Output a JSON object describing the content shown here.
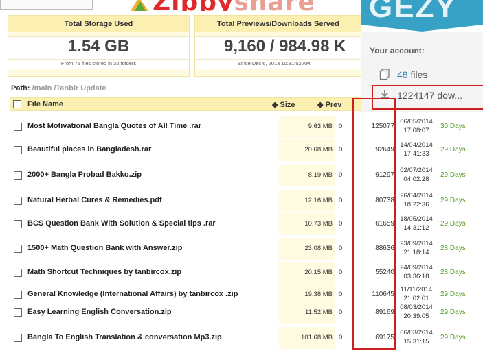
{
  "header": {
    "logo": {
      "part1": "Zippy",
      "part2": "share"
    },
    "badge_text": "GEZY"
  },
  "storage": {
    "title": "Total Storage Used",
    "value": "1.54 GB",
    "subtitle": "From  75 files stored in 32 folders"
  },
  "previews": {
    "title": "Total Previews/Downloads Served",
    "value": "9,160 / 984.98 K",
    "subtitle": "Since Dec 6, 2013 10:31:52 AM"
  },
  "account": {
    "title": "Your account:",
    "files": {
      "count": "48",
      "label": "files",
      "icon": "files-icon"
    },
    "downloads": {
      "text": "1224147 dow...",
      "icon": "download-icon"
    }
  },
  "path": {
    "label": "Path:",
    "value": "/main /Tanbir Update"
  },
  "table": {
    "headers": {
      "name": "File Name",
      "size": "Size",
      "prev": "Prev"
    },
    "rows": [
      {
        "name": "Most Motivational Bangla Quotes of All Time .rar",
        "size": "9.63 MB",
        "prev": "0",
        "downloads": "125077",
        "date": "06/05/2014",
        "time": "17:08:07",
        "days": "30 Days"
      },
      {
        "name": "Beautiful places in Bangladesh.rar",
        "size": "20.68 MB",
        "prev": "0",
        "downloads": "92649",
        "date": "14/04/2014",
        "time": "17:41:33",
        "days": "29 Days"
      },
      {
        "name": "2000+ Bangla Probad Bakko.zip",
        "size": "8.19 MB",
        "prev": "0",
        "downloads": "91297",
        "date": "02/07/2014",
        "time": "04:02:28",
        "days": "29 Days"
      },
      {
        "name": "Natural Herbal Cures & Remedies.pdf",
        "size": "12.16 MB",
        "prev": "0",
        "downloads": "80738",
        "date": "26/04/2014",
        "time": "18:22:36",
        "days": "29 Days"
      },
      {
        "name": "BCS Question Bank With Solution & Special tips .rar",
        "size": "10.73 MB",
        "prev": "0",
        "downloads": "61659",
        "date": "18/05/2014",
        "time": "14:31:12",
        "days": "29 Days"
      },
      {
        "name": "1500+ Math Question Bank with Answer.zip",
        "size": "23.08 MB",
        "prev": "0",
        "downloads": "88636",
        "date": "23/09/2014",
        "time": "21:18:14",
        "days": "28 Days"
      },
      {
        "name": "Math Shortcut Techniques by tanbircox.zip",
        "size": "20.15 MB",
        "prev": "0",
        "downloads": "55240",
        "date": "24/09/2014",
        "time": "03:36:18",
        "days": "28 Days"
      },
      {
        "name": "General Knowledge (International Affairs) by tanbircox .zip",
        "size": "19.38 MB",
        "prev": "0",
        "downloads": "110645",
        "date": "11/11/2014",
        "time": "21:02:01",
        "days": "29 Days"
      },
      {
        "name": "Easy Learning English Conversation.zip",
        "size": "11.52 MB",
        "prev": "0",
        "downloads": "89169",
        "date": "08/03/2014",
        "time": "20:39:05",
        "days": "29 Days"
      },
      {
        "name": "Bangla To English Translation & conversation Mp3.zip",
        "size": "101.68 MB",
        "prev": "0",
        "downloads": "69175",
        "date": "06/03/2014",
        "time": "15:31:15",
        "days": "29 Days"
      }
    ]
  },
  "colors": {
    "panel_bg": "#fffbe0",
    "header_bg": "#fbefb2",
    "days_green": "#4c9a1e",
    "highlight_red": "#cc1f1f",
    "badge_blue": "#37a2c6"
  }
}
